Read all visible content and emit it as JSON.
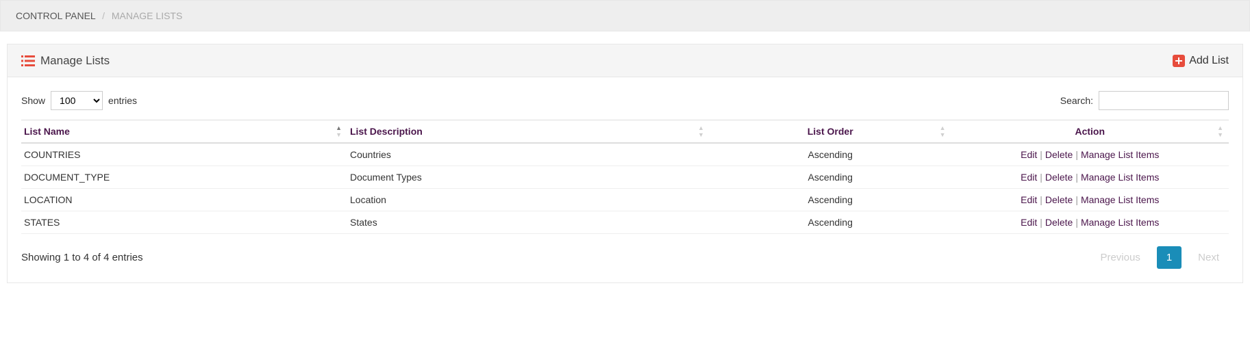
{
  "breadcrumb": {
    "root": "CONTROL PANEL",
    "separator": "/",
    "current": "MANAGE LISTS"
  },
  "panel": {
    "title": "Manage Lists",
    "add_list_label": "Add List"
  },
  "datatable": {
    "length": {
      "show_label": "Show",
      "entries_label": "entries",
      "value": "100"
    },
    "search": {
      "label": "Search:",
      "value": ""
    },
    "columns": {
      "list_name": "List Name",
      "list_description": "List Description",
      "list_order": "List Order",
      "action": "Action"
    },
    "rows": [
      {
        "name": "COUNTRIES",
        "description": "Countries",
        "order": "Ascending"
      },
      {
        "name": "DOCUMENT_TYPE",
        "description": "Document Types",
        "order": "Ascending"
      },
      {
        "name": "LOCATION",
        "description": "Location",
        "order": "Ascending"
      },
      {
        "name": "STATES",
        "description": "States",
        "order": "Ascending"
      }
    ],
    "actions": {
      "edit": "Edit",
      "delete": "Delete",
      "manage_items": "Manage List Items",
      "separator": "|"
    },
    "info": "Showing 1 to 4 of 4 entries",
    "pagination": {
      "previous": "Previous",
      "next": "Next",
      "current_page": "1"
    }
  }
}
